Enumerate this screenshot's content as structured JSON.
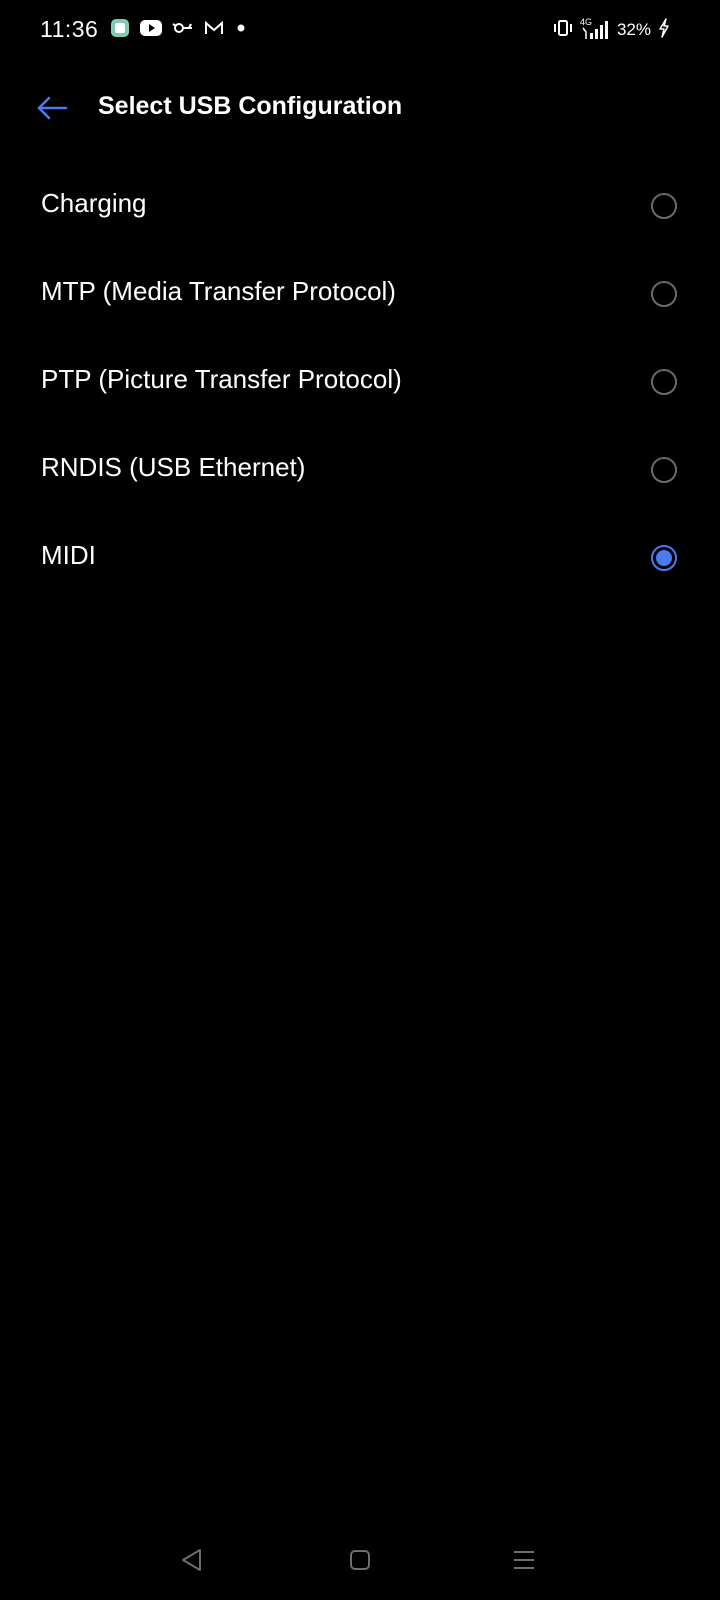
{
  "status_bar": {
    "time": "11:36",
    "notification_icons": [
      "app-notification-icon",
      "youtube-icon",
      "vpn-key-icon",
      "gmail-icon",
      "more-dot-icon"
    ],
    "vibrate_icon": "vibrate-icon",
    "network_label": "4G",
    "battery_percent": "32%",
    "charging_icon": "charging-bolt-icon"
  },
  "header": {
    "back_icon": "back-arrow-icon",
    "title": "Select USB Configuration"
  },
  "options": [
    {
      "label": "Charging",
      "selected": false
    },
    {
      "label": "MTP (Media Transfer Protocol)",
      "selected": false
    },
    {
      "label": "PTP (Picture Transfer Protocol)",
      "selected": false
    },
    {
      "label": "RNDIS (USB Ethernet)",
      "selected": false
    },
    {
      "label": "MIDI",
      "selected": true
    }
  ],
  "nav_bar": {
    "back": "nav-back-icon",
    "home": "nav-home-icon",
    "recents": "nav-recents-icon"
  },
  "colors": {
    "background": "#000000",
    "accent": "#4a7cf0",
    "radio_off": "#6b6b6b",
    "text": "#ffffff"
  }
}
